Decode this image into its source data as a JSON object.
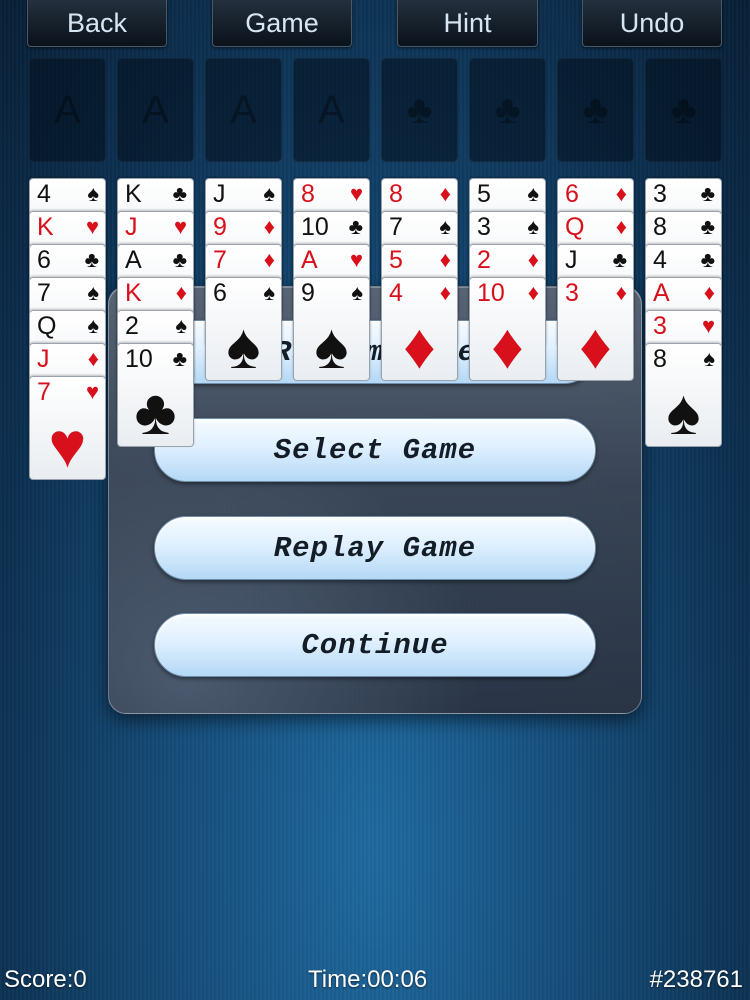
{
  "toolbar": {
    "back": "Back",
    "game": "Game",
    "hint": "Hint",
    "undo": "Undo"
  },
  "slots": {
    "free_cell_icons": [
      "A",
      "A",
      "A",
      "A"
    ],
    "foundation_icons": [
      "club-icon",
      "club-icon",
      "club-icon",
      "club-icon"
    ]
  },
  "columns": [
    [
      {
        "rank": "4",
        "suit": "♠",
        "color": "black"
      },
      {
        "rank": "K",
        "suit": "♥",
        "color": "red"
      },
      {
        "rank": "6",
        "suit": "♣",
        "color": "black"
      },
      {
        "rank": "7",
        "suit": "♠",
        "color": "black"
      },
      {
        "rank": "Q",
        "suit": "♠",
        "color": "black"
      },
      {
        "rank": "J",
        "suit": "♦",
        "color": "red"
      },
      {
        "rank": "7",
        "suit": "♥",
        "color": "red"
      }
    ],
    [
      {
        "rank": "K",
        "suit": "♣",
        "color": "black"
      },
      {
        "rank": "J",
        "suit": "♥",
        "color": "red"
      },
      {
        "rank": "A",
        "suit": "♣",
        "color": "black"
      },
      {
        "rank": "K",
        "suit": "♦",
        "color": "red"
      },
      {
        "rank": "2",
        "suit": "♠",
        "color": "black"
      },
      {
        "rank": "10",
        "suit": "♣",
        "color": "black"
      }
    ],
    [
      {
        "rank": "J",
        "suit": "♠",
        "color": "black"
      },
      {
        "rank": "9",
        "suit": "♦",
        "color": "red"
      },
      {
        "rank": "7",
        "suit": "♦",
        "color": "red"
      },
      {
        "rank": "6",
        "suit": "♠",
        "color": "black"
      }
    ],
    [
      {
        "rank": "8",
        "suit": "♥",
        "color": "red"
      },
      {
        "rank": "10",
        "suit": "♣",
        "color": "black"
      },
      {
        "rank": "A",
        "suit": "♥",
        "color": "red"
      },
      {
        "rank": "9",
        "suit": "♠",
        "color": "black"
      }
    ],
    [
      {
        "rank": "8",
        "suit": "♦",
        "color": "red"
      },
      {
        "rank": "7",
        "suit": "♠",
        "color": "black"
      },
      {
        "rank": "5",
        "suit": "♦",
        "color": "red"
      },
      {
        "rank": "4",
        "suit": "♦",
        "color": "red"
      }
    ],
    [
      {
        "rank": "5",
        "suit": "♠",
        "color": "black"
      },
      {
        "rank": "3",
        "suit": "♠",
        "color": "black"
      },
      {
        "rank": "2",
        "suit": "♦",
        "color": "red"
      },
      {
        "rank": "10",
        "suit": "♦",
        "color": "red"
      }
    ],
    [
      {
        "rank": "6",
        "suit": "♦",
        "color": "red"
      },
      {
        "rank": "Q",
        "suit": "♦",
        "color": "red"
      },
      {
        "rank": "J",
        "suit": "♣",
        "color": "black"
      },
      {
        "rank": "3",
        "suit": "♦",
        "color": "red"
      }
    ],
    [
      {
        "rank": "3",
        "suit": "♣",
        "color": "black"
      },
      {
        "rank": "8",
        "suit": "♣",
        "color": "black"
      },
      {
        "rank": "4",
        "suit": "♣",
        "color": "black"
      },
      {
        "rank": "A",
        "suit": "♦",
        "color": "red"
      },
      {
        "rank": "3",
        "suit": "♥",
        "color": "red"
      },
      {
        "rank": "8",
        "suit": "♠",
        "color": "black"
      }
    ]
  ],
  "menu": {
    "random_game": "Random Game",
    "select_game": "Select Game",
    "replay_game": "Replay Game",
    "continue": "Continue"
  },
  "status": {
    "score": "Score:0",
    "time": "Time:00:06",
    "game_number": "#238761"
  },
  "colors": {
    "red_suit": "#d8101c",
    "black_suit": "#111111",
    "table_blue": "#164f7d"
  }
}
